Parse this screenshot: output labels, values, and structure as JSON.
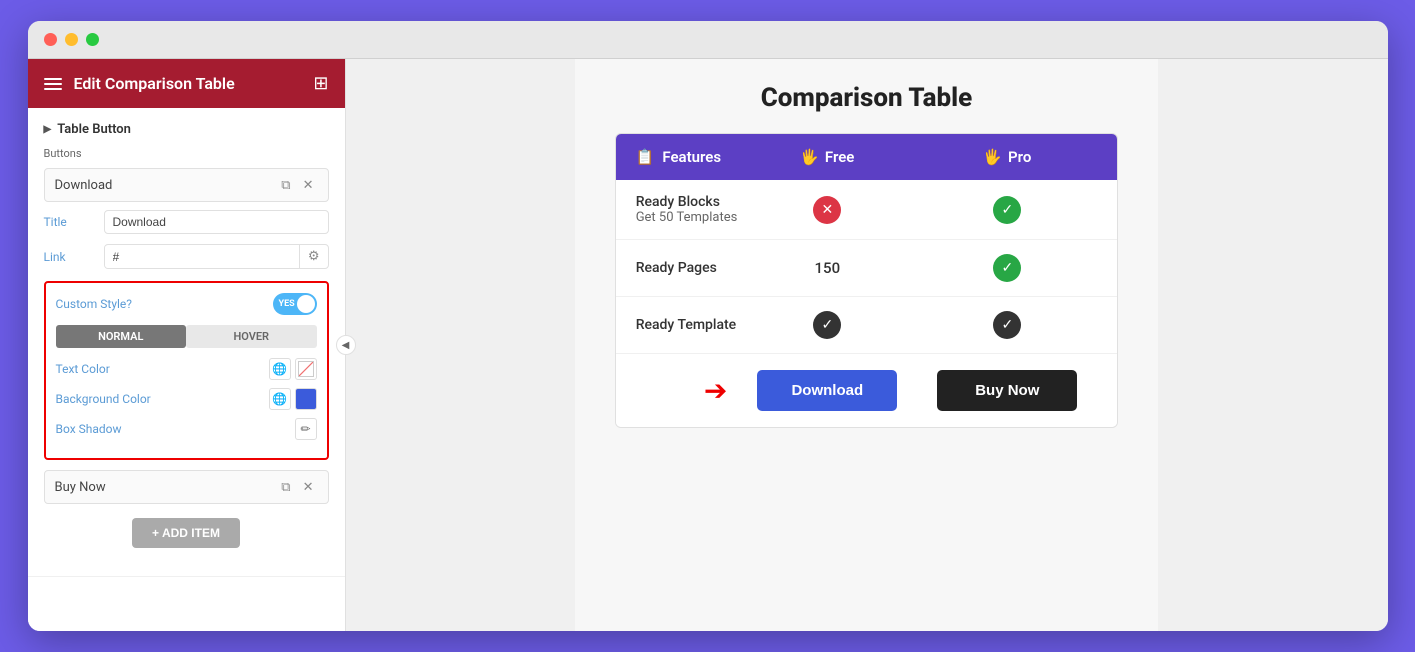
{
  "window": {
    "title": "Edit Comparison Table"
  },
  "sidebar": {
    "title": "Edit Comparison Table",
    "section_label": "Table Button",
    "buttons_label": "Buttons",
    "button1": {
      "label": "Download",
      "title_label": "Title",
      "title_value": "Download",
      "link_label": "Link",
      "link_value": "#"
    },
    "custom_style": {
      "label": "Custom Style?",
      "toggle_yes": "YES",
      "normal_tab": "NORMAL",
      "hover_tab": "HOVER",
      "text_color_label": "Text Color",
      "bg_color_label": "Background Color",
      "bg_color_hex": "#3b5bdb",
      "box_shadow_label": "Box Shadow"
    },
    "button2": {
      "label": "Buy Now"
    },
    "add_item_label": "+ ADD ITEM"
  },
  "main": {
    "page_title": "Comparison Table",
    "table": {
      "header": {
        "features_label": "Features",
        "free_label": "Free",
        "pro_label": "Pro"
      },
      "rows": [
        {
          "feature": "Ready Blocks",
          "feature_sub": "Get 50 Templates",
          "free_value": "cross",
          "pro_value": "check_green"
        },
        {
          "feature": "Ready Pages",
          "free_value": "150",
          "pro_value": "check_green"
        },
        {
          "feature": "Ready Template",
          "free_value": "check_dark",
          "pro_value": "check_dark"
        }
      ],
      "buttons": {
        "download_label": "Download",
        "buynow_label": "Buy Now"
      }
    }
  }
}
